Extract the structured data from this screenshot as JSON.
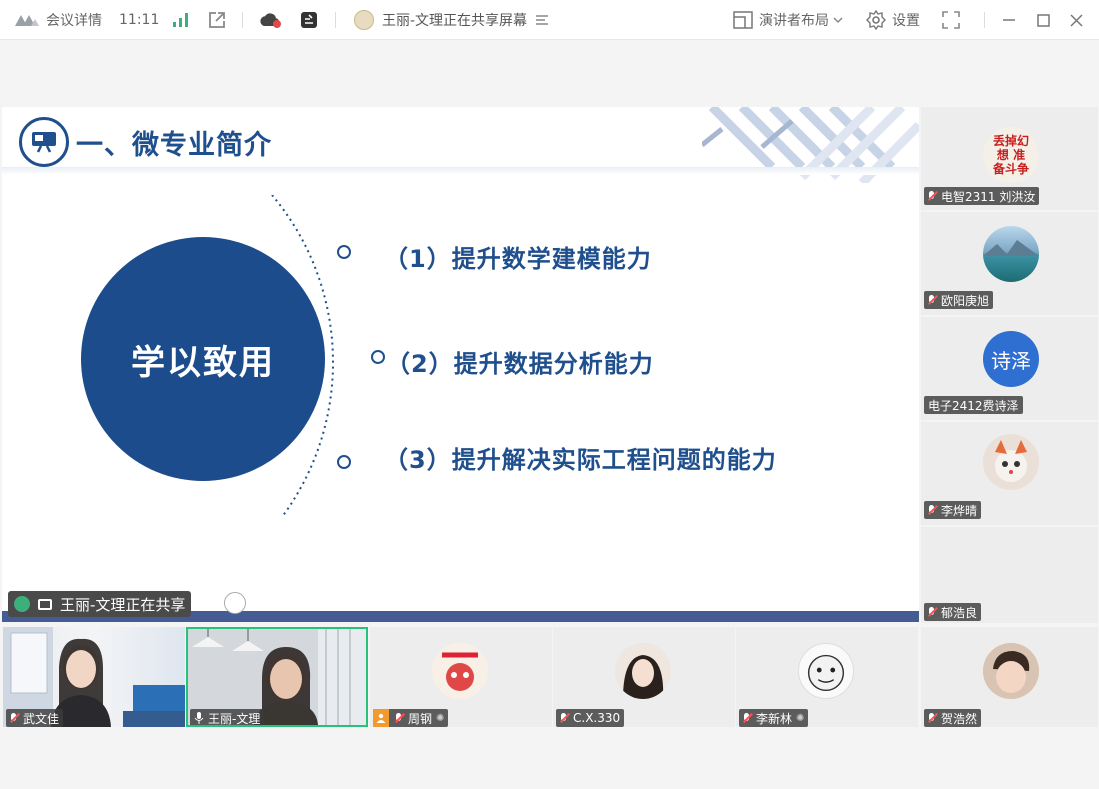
{
  "titlebar": {
    "meeting_details": "会议详情",
    "time": "11:11",
    "sharing_notice": "王丽-文理正在共享屏幕",
    "presenter_layout": "演讲者布局",
    "settings": "设置"
  },
  "slide": {
    "section_title": "一、微专业简介",
    "circle_text": "学以致用",
    "points": [
      "（1）提升数学建模能力",
      "（2）提升数据分析能力",
      "（3）提升解决实际工程问题的能力"
    ]
  },
  "share_tag": {
    "label": "王丽-文理正在共享"
  },
  "side_participants": [
    {
      "name": "电智2311 刘洪汝",
      "avatar_text": "丢掉幻想 准备斗争",
      "muted": true
    },
    {
      "name": "欧阳庚旭",
      "avatar_text": "",
      "muted": true
    },
    {
      "name": "电子2412费诗泽",
      "avatar_text": "诗泽",
      "muted": false
    },
    {
      "name": "李烨晴",
      "avatar_text": "",
      "muted": true
    },
    {
      "name": "郁浩良",
      "avatar_text": "",
      "muted": true
    }
  ],
  "bottom_participants": [
    {
      "name": "武文佳",
      "muted": true
    },
    {
      "name": "王丽-文理",
      "muted": false
    },
    {
      "name": "周钢",
      "muted": true,
      "host": true
    },
    {
      "name": "C.X.330",
      "muted": true
    },
    {
      "name": "李新林",
      "muted": true
    },
    {
      "name": "贺浩然",
      "muted": true
    }
  ],
  "colors": {
    "slide_blue": "#1f4f8c",
    "circle_blue": "#1c4c8c",
    "active_speaker_border": "#27c27a",
    "host_badge": "#f29a2e"
  }
}
